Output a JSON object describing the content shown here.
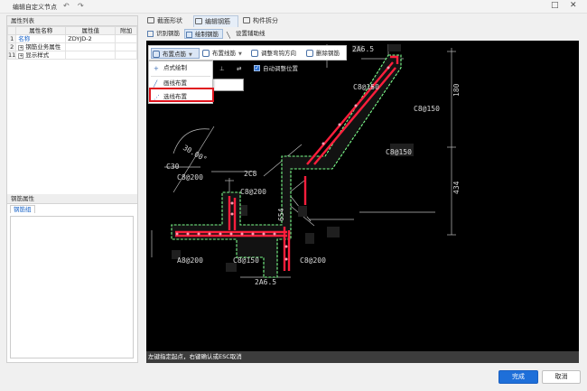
{
  "window": {
    "title": "编辑自定义节点"
  },
  "left_panel": {
    "properties_header": "属性列表",
    "columns": [
      "属性名称",
      "属性值",
      "附加"
    ],
    "rows": [
      {
        "num": "1",
        "name": "名称",
        "value": "ZDYJD-2",
        "expand": false
      },
      {
        "num": "2",
        "name": "钢筋业务属性",
        "value": "",
        "expand": true
      },
      {
        "num": "11",
        "name": "显示样式",
        "value": "",
        "expand": true
      }
    ],
    "rebar_header": "钢筋属性",
    "rebar_tab": "钢筋组"
  },
  "tabs": [
    {
      "label": "截面形状",
      "active": false
    },
    {
      "label": "编辑钢筋",
      "active": true
    },
    {
      "label": "构件拆分",
      "active": false
    }
  ],
  "subtools": [
    {
      "label": "识别钢筋",
      "active": false
    },
    {
      "label": "绘制钢筋",
      "active": true
    },
    {
      "label": "设置辅助线",
      "active": false
    }
  ],
  "canvas_toolbar": {
    "place_point": "布置点筋",
    "place_line": "布置线筋",
    "adjust_hook": "调整弯钩方向",
    "delete_rebar": "删除钢筋",
    "auto_adjust": "自动调整位置"
  },
  "dropdown": {
    "items": [
      "点式绘制",
      "画线布置",
      "选线布置"
    ]
  },
  "drawing_labels": {
    "angle": "30.00°",
    "c30": "C30",
    "c8_200_a": "C8@200",
    "c8_200_b": "C8@200",
    "a8_200": "A8@200",
    "c8_150_a": "C8@150",
    "c8_150_b": "C8@150",
    "c8_150_c": "C8@150",
    "c8_150_d": "C8@150",
    "c8_200_c": "C8@200",
    "rebar_2c8": "2C8",
    "rebar_2a6_5_top": "2A6.5",
    "rebar_2a6_5_bottom": "2A6.5",
    "dim_180": "180",
    "dim_434": "434",
    "dim_654": "654"
  },
  "status": "左键指定起点，右键确认或ESC取消",
  "buttons": {
    "ok": "完成",
    "cancel": "取消"
  },
  "colors": {
    "accent": "#1e6fd9",
    "highlight": "#e0141e",
    "rebar": "#ff1e3c",
    "outline": "#7cff8c"
  }
}
